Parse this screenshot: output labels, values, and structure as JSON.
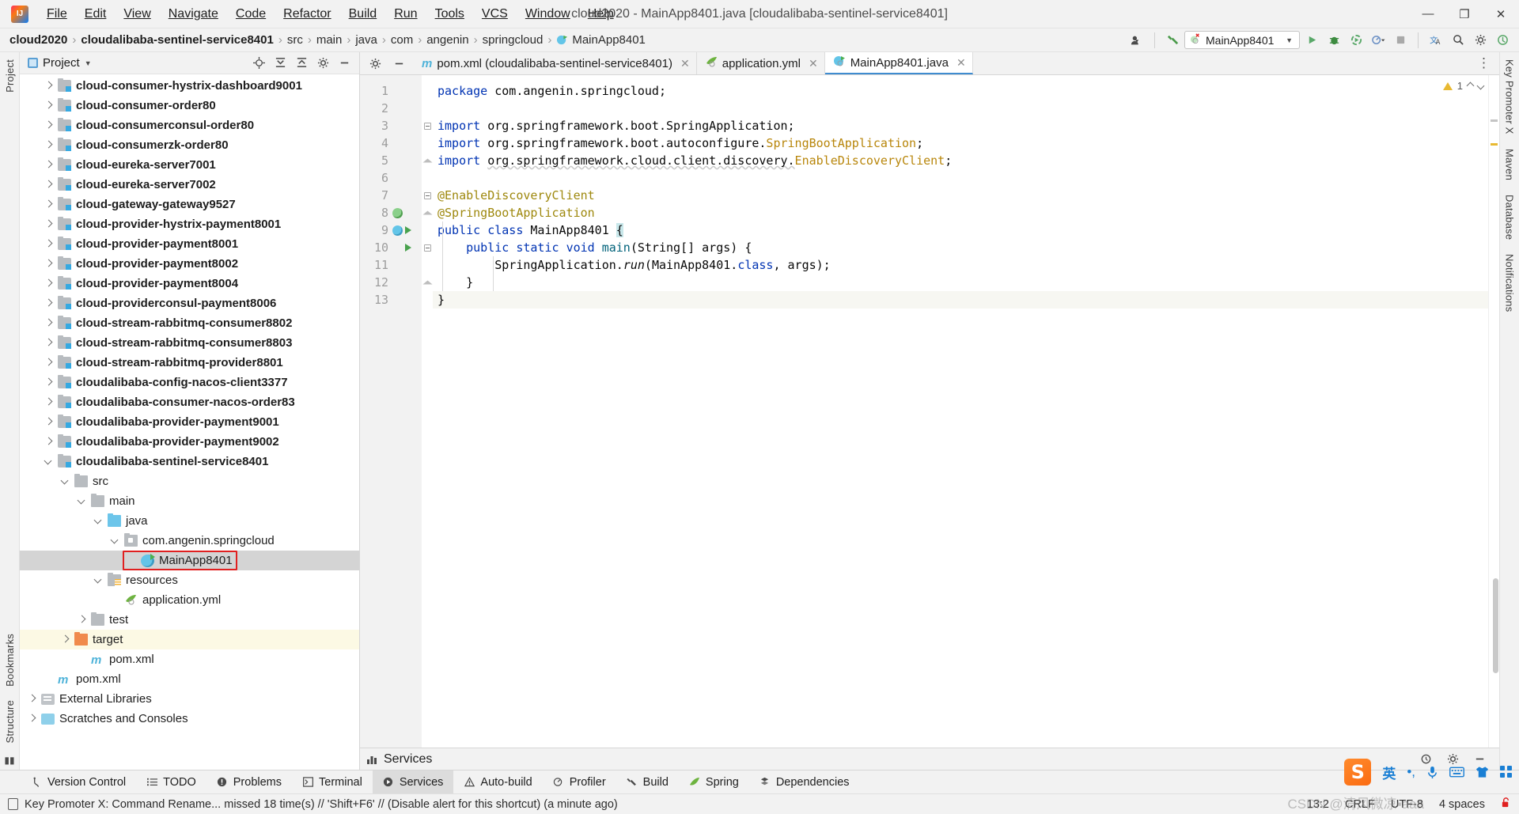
{
  "titlebar": {
    "logo_icon": "intellij-logo-icon",
    "window_title": "cloud2020 - MainApp8401.java [cloudalibaba-sentinel-service8401]",
    "menus": [
      "File",
      "Edit",
      "View",
      "Navigate",
      "Code",
      "Refactor",
      "Build",
      "Run",
      "Tools",
      "VCS",
      "Window",
      "Help"
    ],
    "minimize": "—",
    "maximize": "❐",
    "close": "✕"
  },
  "navbar": {
    "crumbs": [
      "cloud2020",
      "cloudalibaba-sentinel-service8401",
      "src",
      "main",
      "java",
      "com",
      "angenin",
      "springcloud",
      "MainApp8401"
    ],
    "separator": "›",
    "run_config": "MainApp8401",
    "icons": {
      "user": "user-avatar-icon",
      "build": "hammer-icon",
      "run": "run-icon",
      "debug": "debug-icon",
      "run_coverage": "run-with-coverage-icon",
      "profile": "profiler-dropdown-icon",
      "stop": "stop-icon",
      "translate": "translate-icon",
      "search": "search-everywhere-icon",
      "settings": "settings-gear-icon",
      "updates": "updates-icon"
    }
  },
  "left_rail": {
    "top_label": "Project",
    "bottom_label": "Bookmarks",
    "structure_label": "Structure"
  },
  "right_rail": {
    "labels": [
      "Key Promoter X",
      "Maven",
      "Database",
      "Notifications"
    ]
  },
  "project_panel": {
    "title": "Project",
    "header_icons": [
      "locate-icon",
      "expand-all-icon",
      "collapse-all-icon",
      "settings-gear-icon",
      "hide-icon"
    ],
    "tree": [
      {
        "label": "cloud-consumer-hystrix-dashboard9001",
        "depth": 1,
        "icon": "module-folder-icon",
        "arrow": "closed",
        "bold": true
      },
      {
        "label": "cloud-consumer-order80",
        "depth": 1,
        "icon": "module-folder-icon",
        "arrow": "closed",
        "bold": true
      },
      {
        "label": "cloud-consumerconsul-order80",
        "depth": 1,
        "icon": "module-folder-icon",
        "arrow": "closed",
        "bold": true
      },
      {
        "label": "cloud-consumerzk-order80",
        "depth": 1,
        "icon": "module-folder-icon",
        "arrow": "closed",
        "bold": true
      },
      {
        "label": "cloud-eureka-server7001",
        "depth": 1,
        "icon": "module-folder-icon",
        "arrow": "closed",
        "bold": true
      },
      {
        "label": "cloud-eureka-server7002",
        "depth": 1,
        "icon": "module-folder-icon",
        "arrow": "closed",
        "bold": true
      },
      {
        "label": "cloud-gateway-gateway9527",
        "depth": 1,
        "icon": "module-folder-icon",
        "arrow": "closed",
        "bold": true
      },
      {
        "label": "cloud-provider-hystrix-payment8001",
        "depth": 1,
        "icon": "module-folder-icon",
        "arrow": "closed",
        "bold": true
      },
      {
        "label": "cloud-provider-payment8001",
        "depth": 1,
        "icon": "module-folder-icon",
        "arrow": "closed",
        "bold": true
      },
      {
        "label": "cloud-provider-payment8002",
        "depth": 1,
        "icon": "module-folder-icon",
        "arrow": "closed",
        "bold": true
      },
      {
        "label": "cloud-provider-payment8004",
        "depth": 1,
        "icon": "module-folder-icon",
        "arrow": "closed",
        "bold": true
      },
      {
        "label": "cloud-providerconsul-payment8006",
        "depth": 1,
        "icon": "module-folder-icon",
        "arrow": "closed",
        "bold": true
      },
      {
        "label": "cloud-stream-rabbitmq-consumer8802",
        "depth": 1,
        "icon": "module-folder-icon",
        "arrow": "closed",
        "bold": true
      },
      {
        "label": "cloud-stream-rabbitmq-consumer8803",
        "depth": 1,
        "icon": "module-folder-icon",
        "arrow": "closed",
        "bold": true
      },
      {
        "label": "cloud-stream-rabbitmq-provider8801",
        "depth": 1,
        "icon": "module-folder-icon",
        "arrow": "closed",
        "bold": true
      },
      {
        "label": "cloudalibaba-config-nacos-client3377",
        "depth": 1,
        "icon": "module-folder-icon",
        "arrow": "closed",
        "bold": true
      },
      {
        "label": "cloudalibaba-consumer-nacos-order83",
        "depth": 1,
        "icon": "module-folder-icon",
        "arrow": "closed",
        "bold": true
      },
      {
        "label": "cloudalibaba-provider-payment9001",
        "depth": 1,
        "icon": "module-folder-icon",
        "arrow": "closed",
        "bold": true
      },
      {
        "label": "cloudalibaba-provider-payment9002",
        "depth": 1,
        "icon": "module-folder-icon",
        "arrow": "closed",
        "bold": true
      },
      {
        "label": "cloudalibaba-sentinel-service8401",
        "depth": 1,
        "icon": "module-folder-icon",
        "arrow": "open",
        "bold": true
      },
      {
        "label": "src",
        "depth": 2,
        "icon": "folder-icon",
        "arrow": "open",
        "bold": false
      },
      {
        "label": "main",
        "depth": 3,
        "icon": "folder-icon",
        "arrow": "open",
        "bold": false
      },
      {
        "label": "java",
        "depth": 4,
        "icon": "source-folder-icon",
        "arrow": "open",
        "bold": false
      },
      {
        "label": "com.angenin.springcloud",
        "depth": 5,
        "icon": "package-icon",
        "arrow": "open",
        "bold": false
      },
      {
        "label": "MainApp8401",
        "depth": 6,
        "icon": "spring-boot-class-icon",
        "arrow": "none",
        "bold": false,
        "selected": true,
        "boxed": true
      },
      {
        "label": "resources",
        "depth": 4,
        "icon": "resources-folder-icon",
        "arrow": "open",
        "bold": false
      },
      {
        "label": "application.yml",
        "depth": 5,
        "icon": "spring-yaml-icon",
        "arrow": "none",
        "bold": false
      },
      {
        "label": "test",
        "depth": 3,
        "icon": "folder-icon",
        "arrow": "closed",
        "bold": false
      },
      {
        "label": "target",
        "depth": 2,
        "icon": "target-folder-icon",
        "arrow": "closed",
        "bold": false,
        "highlight": true
      },
      {
        "label": "pom.xml",
        "depth": 3,
        "icon": "maven-icon",
        "arrow": "none",
        "bold": false
      },
      {
        "label": "pom.xml",
        "depth": 1,
        "icon": "maven-icon",
        "arrow": "none",
        "bold": false
      },
      {
        "label": "External Libraries",
        "depth": 0,
        "icon": "external-libraries-icon",
        "arrow": "closed",
        "bold": false
      },
      {
        "label": "Scratches and Consoles",
        "depth": 0,
        "icon": "scratches-icon",
        "arrow": "closed",
        "bold": false
      }
    ]
  },
  "editor": {
    "tabs": [
      {
        "label": "pom.xml (cloudalibaba-sentinel-service8401)",
        "icon": "maven-icon",
        "active": false,
        "close": "✕"
      },
      {
        "label": "application.yml",
        "icon": "spring-yaml-icon",
        "active": false,
        "close": "✕"
      },
      {
        "label": "MainApp8401.java",
        "icon": "spring-boot-class-icon",
        "active": true,
        "close": "✕"
      }
    ],
    "inspection_warnings": "1",
    "lines": [
      {
        "n": "1",
        "gutter": null
      },
      {
        "n": "2",
        "gutter": null
      },
      {
        "n": "3",
        "gutter": null
      },
      {
        "n": "4",
        "gutter": null
      },
      {
        "n": "5",
        "gutter": null
      },
      {
        "n": "6",
        "gutter": null
      },
      {
        "n": "7",
        "gutter": null
      },
      {
        "n": "8",
        "gutter": "spring-bean-icon"
      },
      {
        "n": "9",
        "gutter": "run-class-icon"
      },
      {
        "n": "10",
        "gutter": "run-method-icon"
      },
      {
        "n": "11",
        "gutter": null
      },
      {
        "n": "12",
        "gutter": null
      },
      {
        "n": "13",
        "gutter": null
      }
    ],
    "code_text": [
      "package com.angenin.springcloud;",
      "",
      "import org.springframework.boot.SpringApplication;",
      "import org.springframework.boot.autoconfigure.SpringBootApplication;",
      "import org.springframework.cloud.client.discovery.EnableDiscoveryClient;",
      "",
      "@EnableDiscoveryClient",
      "@SpringBootApplication",
      "public class MainApp8401 {",
      "    public static void main(String[] args) {",
      "        SpringApplication.run(MainApp8401.class, args);",
      "    }",
      "}"
    ]
  },
  "services_panel": {
    "title": "Services",
    "icons": [
      "services-icon",
      "settings-gear-icon",
      "minimize-icon"
    ]
  },
  "tool_windows": [
    {
      "label": "Version Control",
      "icon": "branch-icon",
      "active": false
    },
    {
      "label": "TODO",
      "icon": "todo-list-icon",
      "active": false
    },
    {
      "label": "Problems",
      "icon": "problems-icon",
      "active": false
    },
    {
      "label": "Terminal",
      "icon": "terminal-icon",
      "active": false
    },
    {
      "label": "Services",
      "icon": "services-icon",
      "active": true
    },
    {
      "label": "Auto-build",
      "icon": "warning-triangle-icon",
      "active": false
    },
    {
      "label": "Profiler",
      "icon": "profiler-icon",
      "active": false
    },
    {
      "label": "Build",
      "icon": "hammer-icon",
      "active": false
    },
    {
      "label": "Spring",
      "icon": "spring-leaf-icon",
      "active": false
    },
    {
      "label": "Dependencies",
      "icon": "dependencies-icon",
      "active": false
    }
  ],
  "statusbar": {
    "message": "Key Promoter X: Command Rename... missed 18 time(s) // 'Shift+F6' // (Disable alert for this shortcut) (a minute ago)",
    "message_icon": "notification-icon",
    "caret_position": "13:2",
    "line_separator": "CRLF",
    "encoding": "UTF-8",
    "indent": "4 spaces",
    "lock_icon": "unlocked-icon"
  },
  "tray": {
    "sogou_label": "S",
    "items": [
      "英",
      "•,",
      "🎤",
      "⌨",
      "👕",
      "∷"
    ],
    "watermark": "CSDN @清风微凉▪aaa"
  },
  "colors": {
    "accent_blue": "#3f8cd0",
    "keyword_blue": "#0033b3",
    "annotation_gold": "#9e880d",
    "string_green": "#067d17",
    "selection_grey": "#d4d4d4",
    "red_box": "#e02020",
    "target_highlight": "#fcf9e4"
  }
}
